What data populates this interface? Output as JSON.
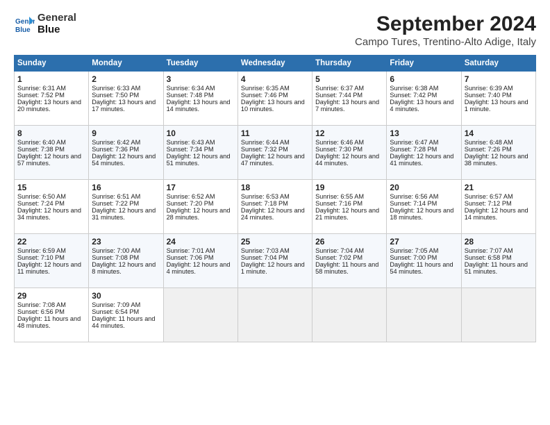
{
  "header": {
    "logo_line1": "General",
    "logo_line2": "Blue",
    "month": "September 2024",
    "location": "Campo Tures, Trentino-Alto Adige, Italy"
  },
  "days_of_week": [
    "Sunday",
    "Monday",
    "Tuesday",
    "Wednesday",
    "Thursday",
    "Friday",
    "Saturday"
  ],
  "weeks": [
    [
      {
        "day": "1",
        "sunrise": "Sunrise: 6:31 AM",
        "sunset": "Sunset: 7:52 PM",
        "daylight": "Daylight: 13 hours and 20 minutes."
      },
      {
        "day": "2",
        "sunrise": "Sunrise: 6:33 AM",
        "sunset": "Sunset: 7:50 PM",
        "daylight": "Daylight: 13 hours and 17 minutes."
      },
      {
        "day": "3",
        "sunrise": "Sunrise: 6:34 AM",
        "sunset": "Sunset: 7:48 PM",
        "daylight": "Daylight: 13 hours and 14 minutes."
      },
      {
        "day": "4",
        "sunrise": "Sunrise: 6:35 AM",
        "sunset": "Sunset: 7:46 PM",
        "daylight": "Daylight: 13 hours and 10 minutes."
      },
      {
        "day": "5",
        "sunrise": "Sunrise: 6:37 AM",
        "sunset": "Sunset: 7:44 PM",
        "daylight": "Daylight: 13 hours and 7 minutes."
      },
      {
        "day": "6",
        "sunrise": "Sunrise: 6:38 AM",
        "sunset": "Sunset: 7:42 PM",
        "daylight": "Daylight: 13 hours and 4 minutes."
      },
      {
        "day": "7",
        "sunrise": "Sunrise: 6:39 AM",
        "sunset": "Sunset: 7:40 PM",
        "daylight": "Daylight: 13 hours and 1 minute."
      }
    ],
    [
      {
        "day": "8",
        "sunrise": "Sunrise: 6:40 AM",
        "sunset": "Sunset: 7:38 PM",
        "daylight": "Daylight: 12 hours and 57 minutes."
      },
      {
        "day": "9",
        "sunrise": "Sunrise: 6:42 AM",
        "sunset": "Sunset: 7:36 PM",
        "daylight": "Daylight: 12 hours and 54 minutes."
      },
      {
        "day": "10",
        "sunrise": "Sunrise: 6:43 AM",
        "sunset": "Sunset: 7:34 PM",
        "daylight": "Daylight: 12 hours and 51 minutes."
      },
      {
        "day": "11",
        "sunrise": "Sunrise: 6:44 AM",
        "sunset": "Sunset: 7:32 PM",
        "daylight": "Daylight: 12 hours and 47 minutes."
      },
      {
        "day": "12",
        "sunrise": "Sunrise: 6:46 AM",
        "sunset": "Sunset: 7:30 PM",
        "daylight": "Daylight: 12 hours and 44 minutes."
      },
      {
        "day": "13",
        "sunrise": "Sunrise: 6:47 AM",
        "sunset": "Sunset: 7:28 PM",
        "daylight": "Daylight: 12 hours and 41 minutes."
      },
      {
        "day": "14",
        "sunrise": "Sunrise: 6:48 AM",
        "sunset": "Sunset: 7:26 PM",
        "daylight": "Daylight: 12 hours and 38 minutes."
      }
    ],
    [
      {
        "day": "15",
        "sunrise": "Sunrise: 6:50 AM",
        "sunset": "Sunset: 7:24 PM",
        "daylight": "Daylight: 12 hours and 34 minutes."
      },
      {
        "day": "16",
        "sunrise": "Sunrise: 6:51 AM",
        "sunset": "Sunset: 7:22 PM",
        "daylight": "Daylight: 12 hours and 31 minutes."
      },
      {
        "day": "17",
        "sunrise": "Sunrise: 6:52 AM",
        "sunset": "Sunset: 7:20 PM",
        "daylight": "Daylight: 12 hours and 28 minutes."
      },
      {
        "day": "18",
        "sunrise": "Sunrise: 6:53 AM",
        "sunset": "Sunset: 7:18 PM",
        "daylight": "Daylight: 12 hours and 24 minutes."
      },
      {
        "day": "19",
        "sunrise": "Sunrise: 6:55 AM",
        "sunset": "Sunset: 7:16 PM",
        "daylight": "Daylight: 12 hours and 21 minutes."
      },
      {
        "day": "20",
        "sunrise": "Sunrise: 6:56 AM",
        "sunset": "Sunset: 7:14 PM",
        "daylight": "Daylight: 12 hours and 18 minutes."
      },
      {
        "day": "21",
        "sunrise": "Sunrise: 6:57 AM",
        "sunset": "Sunset: 7:12 PM",
        "daylight": "Daylight: 12 hours and 14 minutes."
      }
    ],
    [
      {
        "day": "22",
        "sunrise": "Sunrise: 6:59 AM",
        "sunset": "Sunset: 7:10 PM",
        "daylight": "Daylight: 12 hours and 11 minutes."
      },
      {
        "day": "23",
        "sunrise": "Sunrise: 7:00 AM",
        "sunset": "Sunset: 7:08 PM",
        "daylight": "Daylight: 12 hours and 8 minutes."
      },
      {
        "day": "24",
        "sunrise": "Sunrise: 7:01 AM",
        "sunset": "Sunset: 7:06 PM",
        "daylight": "Daylight: 12 hours and 4 minutes."
      },
      {
        "day": "25",
        "sunrise": "Sunrise: 7:03 AM",
        "sunset": "Sunset: 7:04 PM",
        "daylight": "Daylight: 12 hours and 1 minute."
      },
      {
        "day": "26",
        "sunrise": "Sunrise: 7:04 AM",
        "sunset": "Sunset: 7:02 PM",
        "daylight": "Daylight: 11 hours and 58 minutes."
      },
      {
        "day": "27",
        "sunrise": "Sunrise: 7:05 AM",
        "sunset": "Sunset: 7:00 PM",
        "daylight": "Daylight: 11 hours and 54 minutes."
      },
      {
        "day": "28",
        "sunrise": "Sunrise: 7:07 AM",
        "sunset": "Sunset: 6:58 PM",
        "daylight": "Daylight: 11 hours and 51 minutes."
      }
    ],
    [
      {
        "day": "29",
        "sunrise": "Sunrise: 7:08 AM",
        "sunset": "Sunset: 6:56 PM",
        "daylight": "Daylight: 11 hours and 48 minutes."
      },
      {
        "day": "30",
        "sunrise": "Sunrise: 7:09 AM",
        "sunset": "Sunset: 6:54 PM",
        "daylight": "Daylight: 11 hours and 44 minutes."
      },
      null,
      null,
      null,
      null,
      null
    ]
  ]
}
